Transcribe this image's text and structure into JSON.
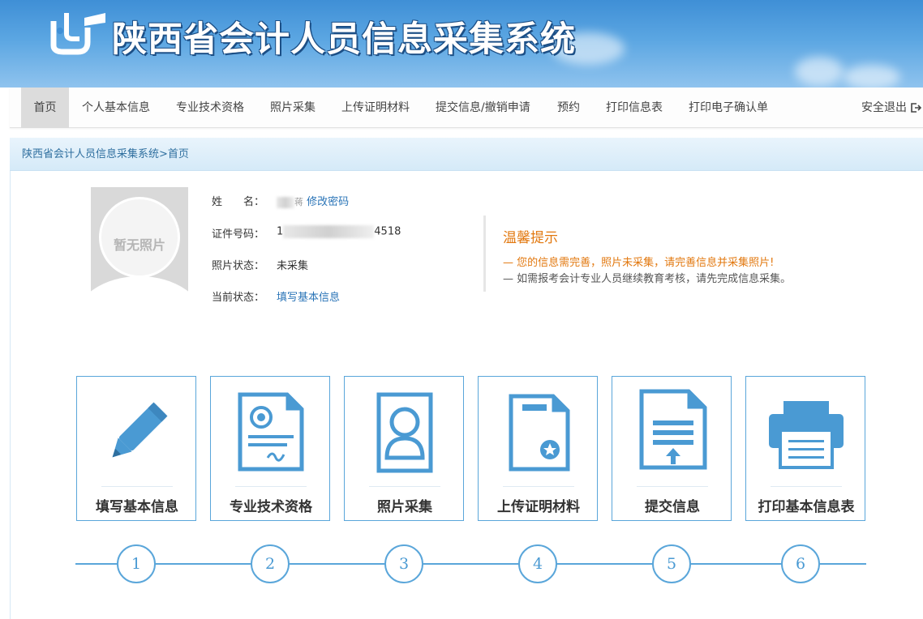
{
  "header": {
    "site_title": "陕西省会计人员信息采集系统"
  },
  "nav": {
    "items": [
      {
        "label": "首页"
      },
      {
        "label": "个人基本信息"
      },
      {
        "label": "专业技术资格"
      },
      {
        "label": "照片采集"
      },
      {
        "label": "上传证明材料"
      },
      {
        "label": "提交信息/撤销申请"
      },
      {
        "label": "预约"
      },
      {
        "label": "打印信息表"
      },
      {
        "label": "打印电子确认单"
      }
    ],
    "logout_label": "安全退出"
  },
  "breadcrumb": "陕西省会计人员信息采集系统>首页",
  "profile": {
    "photo_placeholder": "暂无照片",
    "name_label": "姓　　名：",
    "name_value_partial": "蒋",
    "change_password": "修改密码",
    "id_label": "证件号码：",
    "id_prefix": "1",
    "id_suffix": "4518",
    "photo_status_label": "照片状态：",
    "photo_status_value": "未采集",
    "current_status_label": "当前状态：",
    "current_status_value": "填写基本信息"
  },
  "tips": {
    "title": "温馨提示",
    "line1": "— 您的信息需完善，照片未采集，请完善信息并采集照片!",
    "line2": "— 如需报考会计专业人员继续教育考核，请先完成信息采集。"
  },
  "cards": [
    {
      "label": "填写基本信息",
      "icon": "pencil-icon"
    },
    {
      "label": "专业技术资格",
      "icon": "certificate-icon"
    },
    {
      "label": "照片采集",
      "icon": "portrait-icon"
    },
    {
      "label": "上传证明材料",
      "icon": "document-badge-icon"
    },
    {
      "label": "提交信息",
      "icon": "document-upload-icon"
    },
    {
      "label": "打印基本信息表",
      "icon": "printer-icon"
    }
  ],
  "steps": [
    "1",
    "2",
    "3",
    "4",
    "5",
    "6"
  ],
  "colors": {
    "accent": "#5aa6da",
    "tip_orange": "#e2780f",
    "link": "#2a74b7"
  }
}
